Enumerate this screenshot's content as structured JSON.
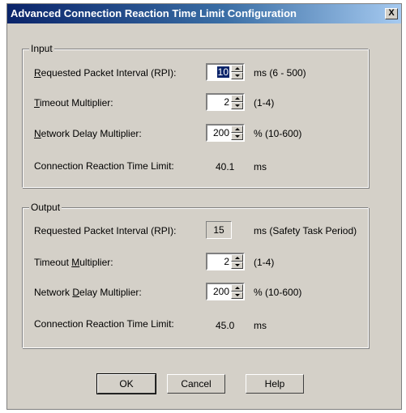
{
  "window": {
    "title": "Advanced Connection Reaction Time Limit Configuration",
    "close_label": "X"
  },
  "input": {
    "legend": "Input",
    "rpi": {
      "label_u": "R",
      "label_rest": "equested Packet Interval (RPI):",
      "value": "10",
      "range": "ms (6 - 500)"
    },
    "timeout": {
      "label_u": "T",
      "label_rest": "imeout Multiplier:",
      "value": "2",
      "range": "(1-4)"
    },
    "delay": {
      "label_u": "N",
      "label_rest": "etwork Delay Multiplier:",
      "value": "200",
      "range": "% (10-600)"
    },
    "limit": {
      "label": "Connection Reaction Time Limit:",
      "value": "40.1",
      "unit": "ms"
    }
  },
  "output": {
    "legend": "Output",
    "rpi": {
      "label": "Requested Packet Interval (RPI):",
      "value": "15",
      "range": "ms (Safety Task Period)"
    },
    "timeout": {
      "label_pre": "Timeout ",
      "label_u": "M",
      "label_rest": "ultiplier:",
      "value": "2",
      "range": "(1-4)"
    },
    "delay": {
      "label_pre": "Network ",
      "label_u": "D",
      "label_rest": "elay Multiplier:",
      "value": "200",
      "range": "% (10-600)"
    },
    "limit": {
      "label": "Connection Reaction Time Limit:",
      "value": "45.0",
      "unit": "ms"
    }
  },
  "buttons": {
    "ok": "OK",
    "cancel": "Cancel",
    "help": "Help"
  }
}
